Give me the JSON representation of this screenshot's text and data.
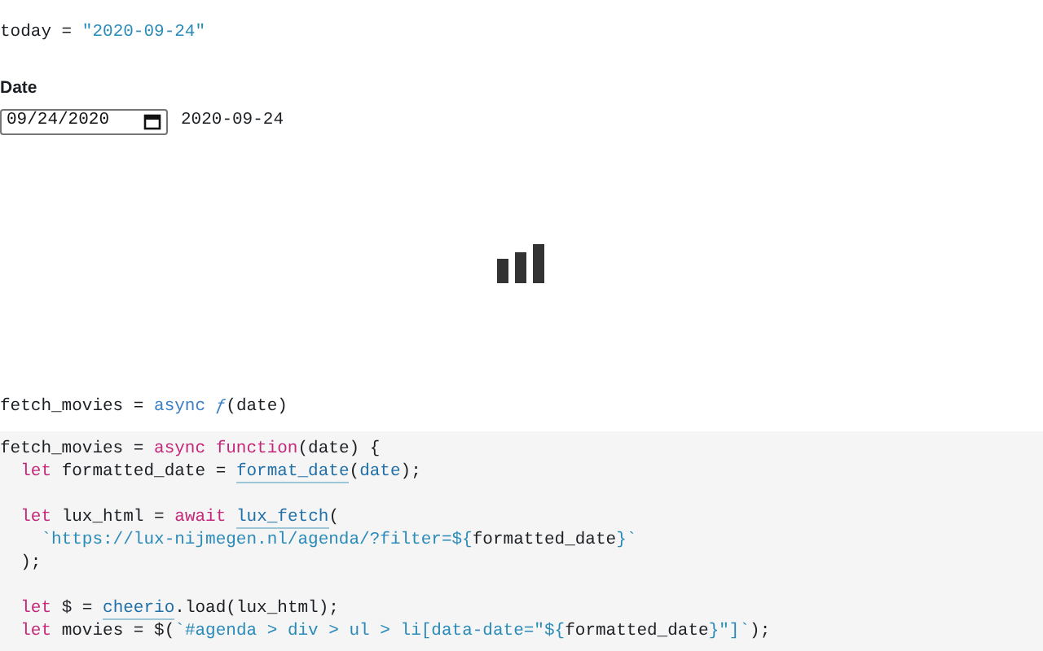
{
  "today_cell": {
    "name": "today",
    "operator": "=",
    "value": "\"2020-09-24\""
  },
  "date_input": {
    "label": "Date",
    "value": "09/24/2020",
    "output": "2020-09-24"
  },
  "fetch_cell": {
    "name": "fetch_movies",
    "operator": "=",
    "keyword": "async",
    "symbol": "ƒ",
    "params": "(date)"
  },
  "code_lines": [
    {
      "kind": "code",
      "tokens": [
        {
          "kind": "plain",
          "text": "fetch_movies = "
        },
        {
          "kind": "keyword",
          "text": "async function"
        },
        {
          "kind": "plain",
          "text": "(date) {"
        }
      ]
    },
    {
      "kind": "code",
      "tokens": [
        {
          "kind": "keyword",
          "text": "  let"
        },
        {
          "kind": "plain",
          "text": " formatted_date = "
        },
        {
          "kind": "ref",
          "text": "format_date"
        },
        {
          "kind": "plain",
          "text": "("
        },
        {
          "kind": "param",
          "text": "date"
        },
        {
          "kind": "plain",
          "text": ");"
        }
      ]
    },
    {
      "kind": "blank"
    },
    {
      "kind": "code",
      "tokens": [
        {
          "kind": "keyword",
          "text": "  let"
        },
        {
          "kind": "plain",
          "text": " lux_html = "
        },
        {
          "kind": "keyword",
          "text": "await"
        },
        {
          "kind": "ref",
          "text": "lux_fetch"
        },
        {
          "kind": "plain",
          "text": "("
        }
      ]
    },
    {
      "kind": "code",
      "tokens": [
        {
          "kind": "string",
          "text": "    `https://lux-nijmegen.nl/agenda/?filter=${"
        },
        {
          "kind": "plain",
          "text": "formatted_date"
        },
        {
          "kind": "string",
          "text": "}`"
        }
      ]
    },
    {
      "kind": "code",
      "tokens": [
        {
          "kind": "plain",
          "text": "  );"
        }
      ]
    },
    {
      "kind": "blank"
    },
    {
      "kind": "code",
      "tokens": [
        {
          "kind": "keyword",
          "text": "  let"
        },
        {
          "kind": "plain",
          "text": " $ = "
        },
        {
          "kind": "ref",
          "text": "cheerio"
        },
        {
          "kind": "plain",
          "text": ".load(lux_html);"
        }
      ]
    },
    {
      "kind": "code",
      "tokens": [
        {
          "kind": "keyword",
          "text": "  let"
        },
        {
          "kind": "plain",
          "text": " movies = $("
        },
        {
          "kind": "string",
          "text": "`#agenda > div > ul > li[data-date=\"${"
        },
        {
          "kind": "plain",
          "text": "formatted_date"
        },
        {
          "kind": "string",
          "text": "}\"]`"
        },
        {
          "kind": "plain",
          "text": ");"
        }
      ]
    }
  ]
}
